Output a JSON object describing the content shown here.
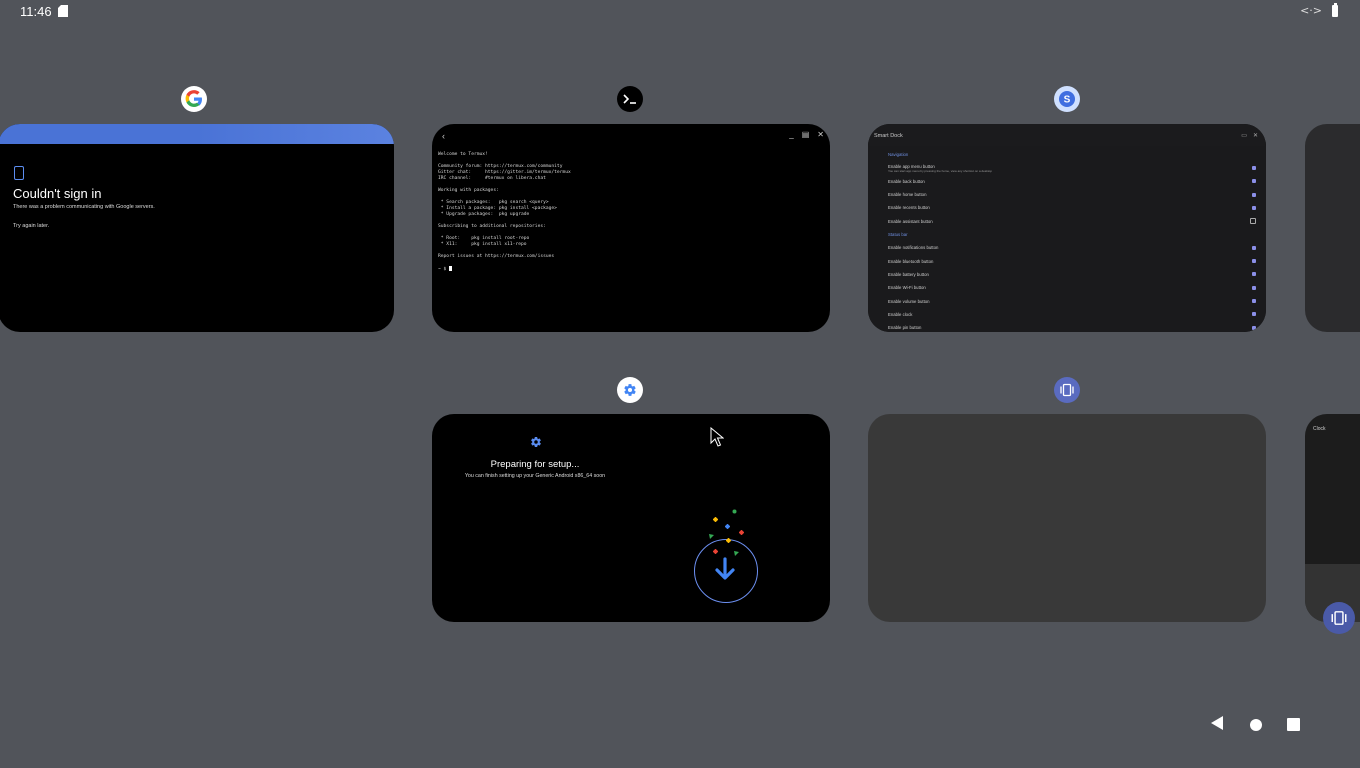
{
  "status_bar": {
    "time": "11:46"
  },
  "cards": {
    "google": {
      "title": "Couldn't sign in",
      "message": "There was a problem communicating with Google servers.",
      "retry": "Try again later."
    },
    "terminal": {
      "lines": [
        "Welcome to Termux!",
        "",
        "Community forum: https://termux.com/community",
        "Gitter chat:     https://gitter.im/termux/termux",
        "IRC channel:     #termux on libera.chat",
        "",
        "Working with packages:",
        "",
        " * Search packages:   pkg search <query>",
        " * Install a package: pkg install <package>",
        " * Upgrade packages:  pkg upgrade",
        "",
        "Subscribing to additional repositories:",
        "",
        " * Root:    pkg install root-repo",
        " * X11:     pkg install x11-repo",
        "",
        "Report issues at https://termux.com/issues",
        ""
      ],
      "prompt": "~ $ "
    },
    "smart_dock": {
      "title": "Smart Dock",
      "rows": [
        {
          "label": "Navigation",
          "type": "section"
        },
        {
          "label": "Enable app menu button",
          "sub": "You can start app menu by pressing the home, view any shortcut on a desktop",
          "checked": true
        },
        {
          "label": "Enable back button",
          "checked": true
        },
        {
          "label": "Enable home button",
          "checked": true
        },
        {
          "label": "Enable recents button",
          "checked": true
        },
        {
          "label": "Enable assistant button",
          "checked": false
        },
        {
          "label": "Status bar",
          "type": "section"
        },
        {
          "label": "Enable notifications button",
          "checked": true
        },
        {
          "label": "Enable bluetooth button",
          "checked": true
        },
        {
          "label": "Enable battery button",
          "checked": true
        },
        {
          "label": "Enable Wi-Fi button",
          "checked": true
        },
        {
          "label": "Enable volume button",
          "checked": true
        },
        {
          "label": "Enable clock",
          "checked": true
        },
        {
          "label": "Enable pin button",
          "checked": true
        }
      ]
    },
    "setup": {
      "title": "Preparing for setup...",
      "subtitle": "You can finish setting up your Generic Android x86_64 soon"
    },
    "peek_bottom": {
      "label": "Clock"
    }
  },
  "colors": {
    "background": "#51545a",
    "google_bar": "#4a73d6",
    "accent_blue": "#4285f4",
    "setup_ring": "#6c8ff0"
  },
  "icons": {
    "google_app": "google-g-icon",
    "terminal_app": "terminal-prompt-icon",
    "smart_dock_app": "smart-dock-s-icon",
    "settings_app": "settings-gear-icon",
    "overview_app": "window-stack-icon"
  }
}
